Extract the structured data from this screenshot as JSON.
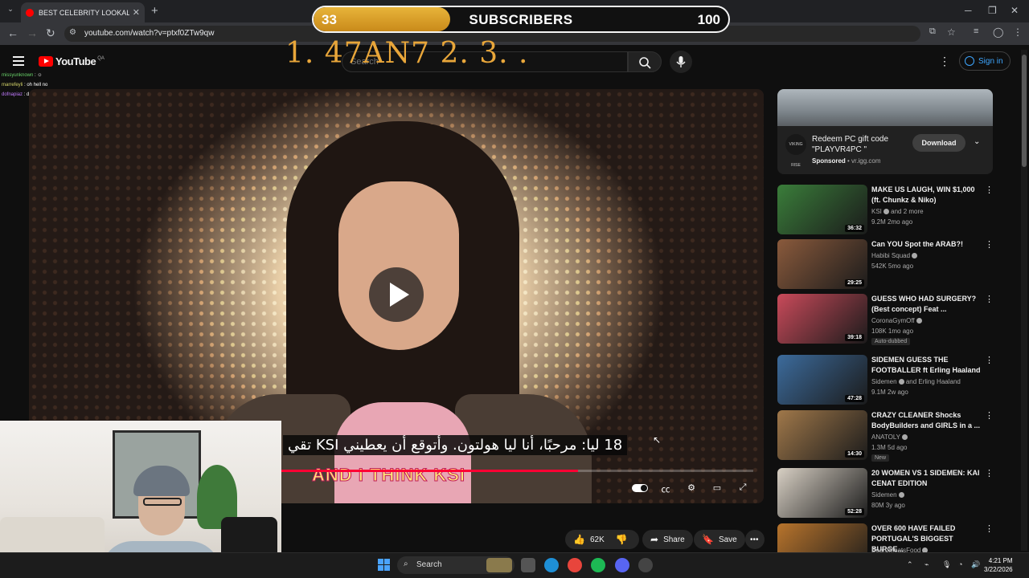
{
  "browser": {
    "tab_title": "BEST CELEBRITY LOOKALIKE WI",
    "tab_close": "✕",
    "new_tab": "+",
    "url": "youtube.com/watch?v=ptxf0ZTw9qw"
  },
  "overlay": {
    "subscriber_current": "33",
    "subscriber_label": "SUBSCRIBERS",
    "subscriber_goal": "100",
    "subscriber_progress": 0.33,
    "stream_text": "1. 47AN7   2.  3.  ."
  },
  "youtube": {
    "logo_text": "YouTube",
    "logo_country": "QA",
    "search_placeholder": "Search",
    "sign_in": "Sign in"
  },
  "chat": [
    {
      "user": "missyunknown",
      "text": ": ☺"
    },
    {
      "user": "marrefeyli",
      "text": ": oh hell no"
    },
    {
      "user": "dofnapiaz",
      "text": ": de fel"
    }
  ],
  "video": {
    "subtitle_arabic": "18 ليا: مرحبًا، أنا ليا هولتون. وأتوقع أن يعطيني KSI تقي",
    "caption_english": "AND I THINK KSI",
    "progress": 0.63
  },
  "actions": {
    "likes": "62K",
    "share": "Share",
    "save": "Save"
  },
  "ad": {
    "title": "Redeem PC gift code \"PLAYVR4PC \"",
    "sponsored": "Sponsored",
    "domain": "vr.igg.com",
    "button": "Download",
    "logo": "VIKING RISE"
  },
  "recommendations": [
    {
      "title": "MAKE US LAUGH, WIN $1,000 (ft. Chunkz & Niko)",
      "channel": "KSI",
      "channel_extra": "and 2 more",
      "stats": "9.2M  2mo ago",
      "duration": "36:32",
      "badge": ""
    },
    {
      "title": "Can YOU Spot the ARAB?!",
      "channel": "Habibi Squad",
      "channel_extra": "",
      "stats": "542K  5mo ago",
      "duration": "29:25",
      "badge": ""
    },
    {
      "title": "GUESS WHO HAD SURGERY? (Best concept) Feat ...",
      "channel": "CoronaGymOff",
      "channel_extra": "",
      "stats": "108K  1mo ago",
      "duration": "39:18",
      "badge": "Auto-dubbed"
    },
    {
      "title": "SIDEMEN GUESS THE FOOTBALLER ft Erling Haaland",
      "channel": "Sidemen",
      "channel_extra": "and Erling Haaland",
      "stats": "9.1M  2w ago",
      "duration": "47:28",
      "badge": ""
    },
    {
      "title": "CRAZY CLEANER Shocks BodyBuilders and GIRLS in a ...",
      "channel": "ANATOLY",
      "channel_extra": "",
      "stats": "1.3M  5d ago",
      "duration": "14:30",
      "badge": "New"
    },
    {
      "title": "20 WOMEN VS 1 SIDEMEN: KAI CENAT EDITION",
      "channel": "Sidemen",
      "channel_extra": "",
      "stats": "80M  3y ago",
      "duration": "52:28",
      "badge": ""
    },
    {
      "title": "OVER 600 HAVE FAILED PORTUGAL'S BIGGEST BURGE...",
      "channel": "BeardMeatsFood",
      "channel_extra": "",
      "stats": "",
      "duration": "",
      "badge": ""
    }
  ],
  "thumb_colors": [
    "#3a7d3a",
    "#8a5a3c",
    "#c94a5a",
    "#3c6b9c",
    "#a0784a",
    "#d8d0c4",
    "#b8742c"
  ],
  "taskbar": {
    "search": "Search",
    "time": "4:21 PM",
    "date": "3/22/2026"
  }
}
